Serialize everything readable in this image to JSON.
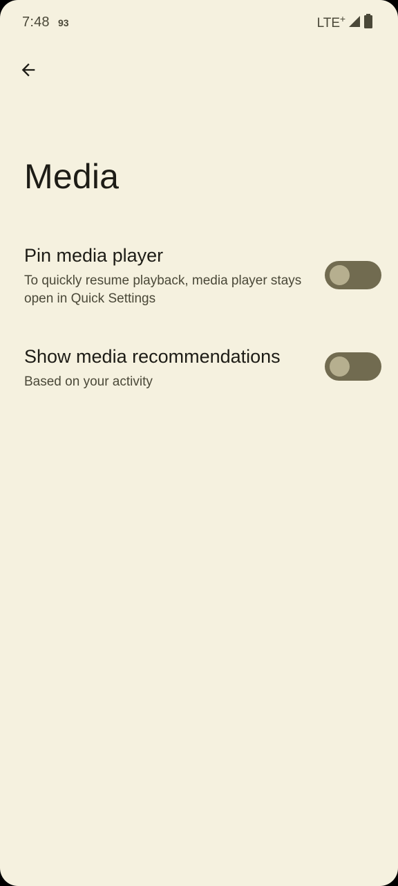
{
  "status_bar": {
    "time": "7:48",
    "notification_count": "93",
    "network": "LTE",
    "network_plus": "+",
    "signal_icon": "signal-icon",
    "battery_icon": "battery-icon"
  },
  "toolbar": {
    "back_icon": "arrow-back-icon"
  },
  "page": {
    "title": "Media"
  },
  "settings": [
    {
      "title": "Pin media player",
      "summary": "To quickly resume playback, media player stays open in Quick Settings",
      "enabled": false
    },
    {
      "title": "Show media recommendations",
      "summary": "Based on your activity",
      "enabled": false
    }
  ],
  "colors": {
    "background": "#f5f1df",
    "toggle_track_off": "#716b50",
    "toggle_thumb_off": "#b6af8f",
    "text_primary": "#1d1c16",
    "text_secondary": "#4a4838"
  }
}
